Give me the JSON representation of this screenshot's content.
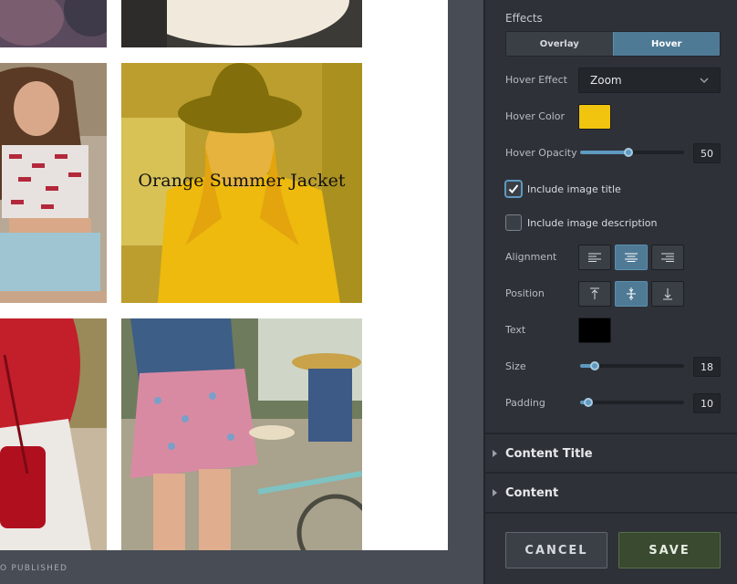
{
  "gallery": {
    "tile_title": "Orange Summer Jacket",
    "published_text": "O PUBLISHED"
  },
  "panel": {
    "effects_label": "Effects",
    "tabs": [
      {
        "label": "Overlay",
        "active": false
      },
      {
        "label": "Hover",
        "active": true
      }
    ],
    "hover_effect": {
      "label": "Hover Effect",
      "value": "Zoom"
    },
    "hover_color": {
      "label": "Hover Color",
      "color": "#f1c40f"
    },
    "hover_opacity": {
      "label": "Hover Opacity",
      "value": "50",
      "fraction": 0.5
    },
    "include_title": {
      "label": "Include image title",
      "checked": true
    },
    "include_description": {
      "label": "Include image description",
      "checked": false
    },
    "alignment": {
      "label": "Alignment",
      "options": [
        "align-left-icon",
        "align-center-icon",
        "align-right-icon"
      ],
      "selected": "center"
    },
    "position": {
      "label": "Position",
      "options": [
        "position-top-icon",
        "position-middle-icon",
        "position-bottom-icon"
      ],
      "selected": "middle"
    },
    "text_color": {
      "label": "Text",
      "color": "#000000"
    },
    "size": {
      "label": "Size",
      "value": "18",
      "fraction": 0.12
    },
    "padding": {
      "label": "Padding",
      "value": "10",
      "fraction": 0.07
    },
    "accordions": [
      "Content Title",
      "Content"
    ],
    "cancel_label": "CANCEL",
    "save_label": "SAVE"
  },
  "colors": {
    "accent": "#5e99c0",
    "active_tab": "#4f7a96",
    "panel_bg": "#2e3238",
    "overlay": "#e8c200",
    "save_bg": "#394a30"
  }
}
